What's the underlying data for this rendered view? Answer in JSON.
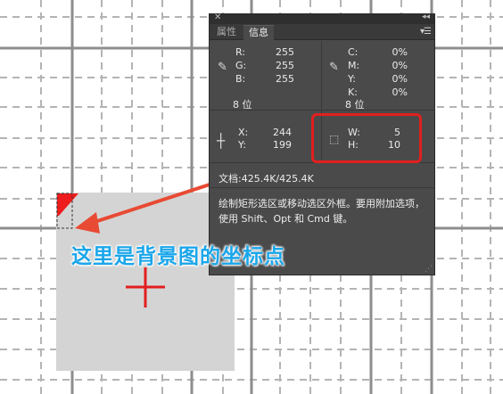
{
  "tabs": [
    "属性",
    "信息"
  ],
  "active_tab": "信息",
  "color_left": {
    "labels": [
      "R:",
      "G:",
      "B:"
    ],
    "values": [
      "255",
      "255",
      "255"
    ],
    "bit_depth": "8 位"
  },
  "color_right": {
    "labels": [
      "C:",
      "M:",
      "Y:",
      "K:"
    ],
    "values": [
      "0%",
      "0%",
      "0%",
      "0%"
    ],
    "bit_depth": "8 位"
  },
  "position": {
    "x_label": "X:",
    "x_value": "244",
    "y_label": "Y:",
    "y_value": "199"
  },
  "size": {
    "w_label": "W:",
    "w_value": "5",
    "h_label": "H:",
    "h_value": "10"
  },
  "document": "文档:425.4K/425.4K",
  "help_text": "绘制矩形选区或移动选区外框。要用附加选项，使用 Shift、Opt 和 Cmd 键。",
  "annotation": "这里是背景图的坐标点",
  "icons": {
    "close": "close-icon",
    "collapse": "collapse-arrows-icon",
    "menu": "panel-menu-icon",
    "eyedropper": "eyedropper-icon",
    "crosshair": "crosshair-icon",
    "selection": "marquee-selection-icon",
    "resize": "resize-grip-icon"
  },
  "colors": {
    "panel_bg": "#4a4a4a",
    "highlight": "#e21f1f",
    "annotation": "#1aa6ea",
    "square": "#d3d3d3",
    "grid": "#a9a9a9"
  }
}
